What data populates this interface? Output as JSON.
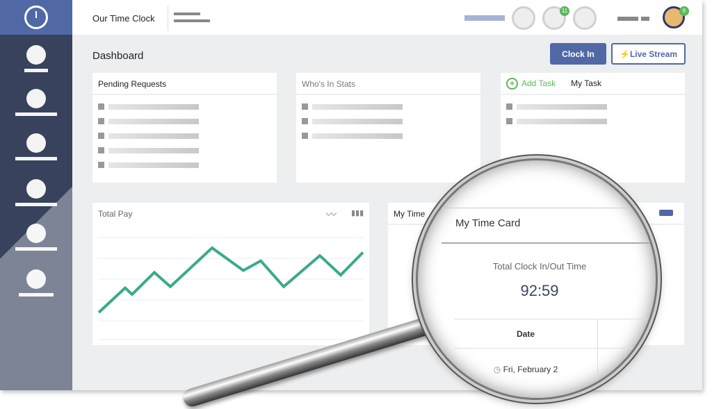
{
  "header": {
    "brand": "Our Time Clock",
    "notification_badge": "11",
    "user_badge": "6"
  },
  "page": {
    "title": "Dashboard"
  },
  "actions": {
    "clock_in": "Clock In",
    "live_stream": "Live Stream"
  },
  "cards": {
    "pending_requests": {
      "title": "Pending Requests",
      "rows": 5
    },
    "whos_in": {
      "title": "Who's In Stats",
      "rows": 3
    },
    "tasks": {
      "add_task": "Add Task",
      "title": "My Task",
      "rows": 2
    },
    "total_pay": {
      "title": "Total Pay",
      "trend": [
        0,
        38,
        28,
        62,
        40,
        100,
        65,
        80,
        40,
        88,
        58,
        93
      ]
    },
    "time_card": {
      "title_partial": "My Time",
      "title": "My Time Card",
      "total_label": "Total Clock In/Out Time",
      "total_value": "92:59",
      "col_date": "Date",
      "date_value": "Fri, February 2"
    }
  },
  "colors": {
    "sidebar": "#38425c",
    "brand": "#5069a6",
    "accent_green": "#5cb85c",
    "chart_line": "#3aaa8c"
  }
}
